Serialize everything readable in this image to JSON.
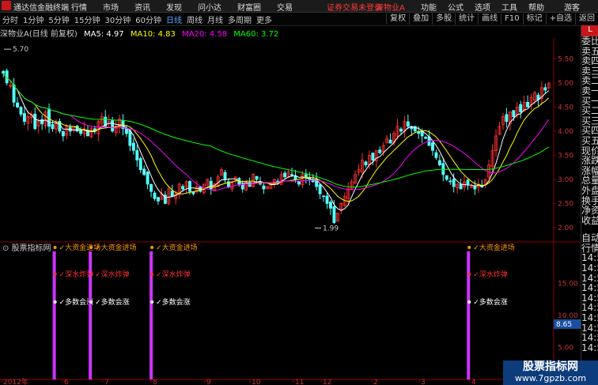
{
  "app_title": "通达信金融终端",
  "menu": [
    "行情",
    "市场",
    "资讯",
    "发现",
    "问小达",
    "财富圈",
    "交易"
  ],
  "notice": "证券交易未登录",
  "stock_name": "深物业A",
  "right_menu": [
    "功能",
    "公式",
    "选项",
    "工具",
    "帮助"
  ],
  "guest": "游客",
  "periods": [
    "分时",
    "1分钟",
    "5分钟",
    "15分钟",
    "30分钟",
    "60分钟",
    "日线",
    "周线",
    "月线",
    "多周期",
    "更多"
  ],
  "active_period": "日线",
  "right_buttons": [
    "复权",
    "叠加",
    "多股",
    "统计",
    "画线",
    "F10",
    "标记",
    "+自选",
    "返回"
  ],
  "ma_line": {
    "title": "深物业A(日线 前复权)",
    "ma5": "MA5: 4.97",
    "ma10": "MA10: 4.83",
    "ma20": "MA20: 4.58",
    "ma60": "MA60: 3.72"
  },
  "colors": {
    "ma5": "#ffffff",
    "ma10": "#ffff00",
    "ma20": "#ff00ff",
    "ma60": "#00ff00",
    "up": "#ff3030",
    "down": "#54ffff"
  },
  "price_high_label": "5.70",
  "price_low_label": "1.99",
  "indicator_label": "股票指标网",
  "signal_labels": [
    "大资金进场",
    "深水炸弹",
    "多数会涨"
  ],
  "x_labels": [
    "2012年",
    "6",
    "7",
    "8",
    "9",
    "10",
    "11",
    "12",
    "2",
    "3",
    "4",
    "5"
  ],
  "side_header": "L",
  "side_labels_top": [
    "委比",
    "卖五",
    "卖四",
    "卖三",
    "卖二",
    "卖一",
    "买一",
    "买二",
    "买三",
    "买四",
    "买五",
    "现价",
    "涨跌",
    "涨幅",
    "总量",
    "外盘",
    "换手",
    "净资",
    "收益"
  ],
  "side_labels_bottom": [
    "自动",
    "行情",
    "14:5",
    "14:5",
    "14:5",
    "14:5",
    "14:5",
    "14:5",
    "14:5",
    "14:5",
    "14:5",
    "14:5"
  ],
  "watermark": {
    "line1": "股票指标网",
    "line2": "www.7gpzb.com"
  },
  "chart_data": {
    "type": "candlestick",
    "price_axis": {
      "ylim": [
        1.8,
        5.9
      ],
      "ticks": [
        5.5,
        5.0,
        4.5,
        4.0,
        3.5,
        3.0,
        2.5,
        2.0
      ]
    },
    "indicator_axis": {
      "ylim": [
        0,
        20
      ],
      "ticks": [
        15.0,
        10.0,
        5.0
      ],
      "current": 8.65
    },
    "signal_positions": [
      0.098,
      0.163,
      0.273,
      0.846
    ],
    "closes": [
      5.2,
      5.0,
      4.95,
      4.6,
      4.5,
      4.35,
      4.2,
      4.3,
      4.35,
      4.05,
      4.2,
      4.15,
      4.4,
      4.1,
      4.05,
      4.15,
      4.0,
      3.9,
      4.1,
      4.0,
      4.1,
      4.0,
      3.95,
      4.05,
      3.9,
      4.05,
      4.0,
      4.2,
      4.3,
      4.1,
      4.2,
      4.0,
      4.1,
      4.25,
      4.05,
      3.95,
      3.7,
      3.6,
      3.4,
      3.2,
      3.1,
      2.9,
      2.75,
      2.6,
      2.55,
      2.7,
      2.5,
      2.8,
      2.65,
      2.7,
      2.9,
      2.8,
      2.95,
      2.75,
      2.7,
      2.85,
      2.75,
      2.9,
      3.0,
      2.8,
      2.9,
      3.05,
      3.2,
      3.0,
      2.85,
      2.95,
      3.05,
      2.9,
      2.8,
      2.95,
      2.85,
      3.1,
      3.0,
      2.9,
      2.8,
      2.85,
      2.9,
      3.0,
      2.95,
      3.1,
      3.05,
      3.15,
      3.1,
      3.0,
      2.9,
      3.1,
      3.05,
      3.0,
      2.95,
      2.85,
      2.7,
      2.65,
      2.5,
      2.4,
      2.1,
      2.3,
      2.5,
      2.65,
      2.8,
      2.95,
      3.1,
      3.2,
      3.4,
      3.3,
      3.5,
      3.4,
      3.6,
      3.55,
      3.7,
      3.85,
      3.75,
      3.95,
      4.1,
      4.0,
      4.2,
      4.1,
      4.05,
      4.0,
      3.95,
      3.9,
      3.85,
      3.7,
      3.6,
      3.45,
      3.3,
      3.1,
      3.0,
      2.95,
      2.85,
      2.9,
      2.8,
      2.95,
      2.9,
      2.85,
      2.8,
      2.9,
      2.85,
      3.0,
      3.3,
      3.6,
      3.9,
      4.1,
      4.3,
      4.2,
      4.4,
      4.3,
      4.5,
      4.4,
      4.6,
      4.5,
      4.7,
      4.8,
      4.65,
      4.9,
      4.85,
      5.0
    ]
  }
}
